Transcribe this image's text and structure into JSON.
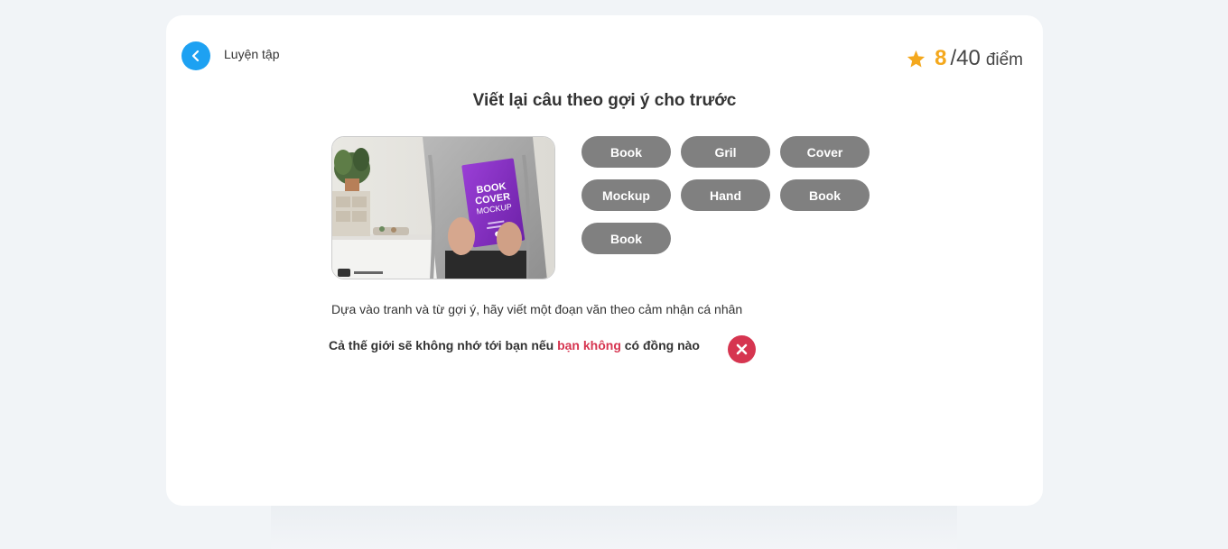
{
  "header": {
    "back_label": "Luyện tập",
    "score_current": "8",
    "score_total": "/40",
    "score_unit": "điểm"
  },
  "task": {
    "title": "Viết lại câu theo gợi ý cho trước",
    "instruction": "Dựa vào tranh và từ gợi ý, hãy viết một đoạn văn theo cảm nhận cá nhân"
  },
  "chips": [
    "Book",
    "Gril",
    "Cover",
    "Mockup",
    "Hand",
    "Book",
    "Book"
  ],
  "photo": {
    "line1": "BOOK",
    "line2": "COVER",
    "line3": "MOCKUP"
  },
  "answer": {
    "part1": "Cả thế giới sẽ không nhớ tới bạn nếu ",
    "highlight": "bạn không",
    "part2": " có đồng nào",
    "status": "incorrect"
  },
  "colors": {
    "accent": "#1da1f2",
    "score": "#f4a81d",
    "error": "#d63550",
    "chip": "#808080"
  }
}
